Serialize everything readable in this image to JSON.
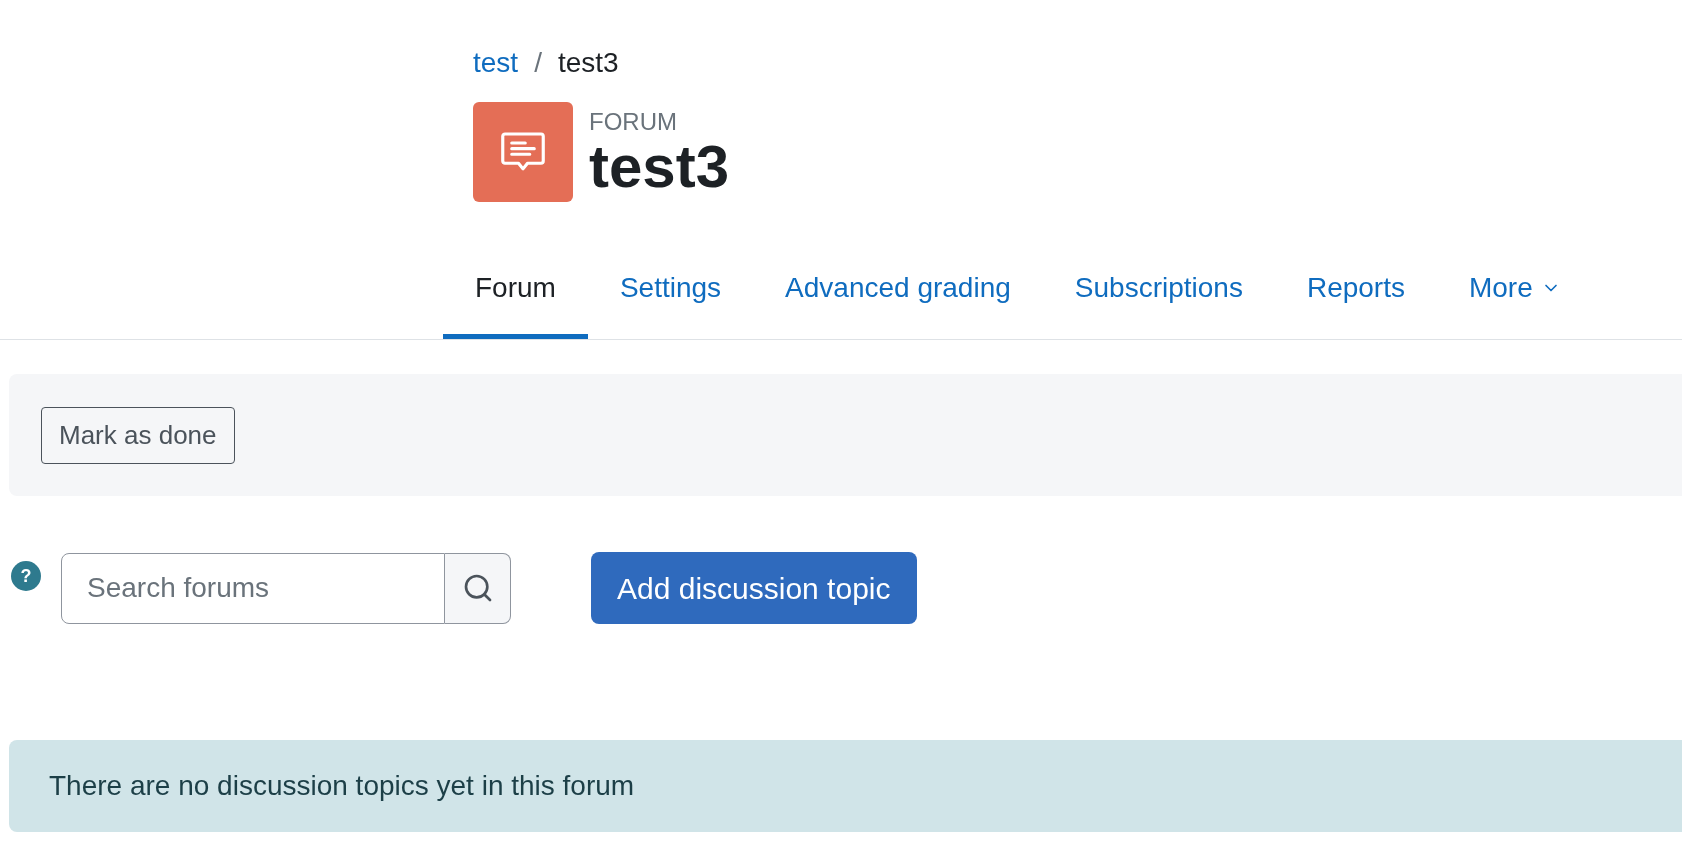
{
  "breadcrumb": [
    {
      "label": "test",
      "link": true
    },
    {
      "label": "test3",
      "link": false
    }
  ],
  "breadcrumb_separator": "/",
  "activity": {
    "type": "FORUM",
    "title": "test3"
  },
  "tabs": [
    {
      "label": "Forum",
      "selected": true,
      "dropdown": false
    },
    {
      "label": "Settings",
      "selected": false,
      "dropdown": false
    },
    {
      "label": "Advanced grading",
      "selected": false,
      "dropdown": false
    },
    {
      "label": "Subscriptions",
      "selected": false,
      "dropdown": false
    },
    {
      "label": "Reports",
      "selected": false,
      "dropdown": false
    },
    {
      "label": "More",
      "selected": false,
      "dropdown": true
    }
  ],
  "completion": {
    "button": "Mark as done"
  },
  "help": "?",
  "search": {
    "placeholder": "Search forums"
  },
  "add_button": "Add discussion topic",
  "notice": "There are no discussion topics yet in this forum"
}
